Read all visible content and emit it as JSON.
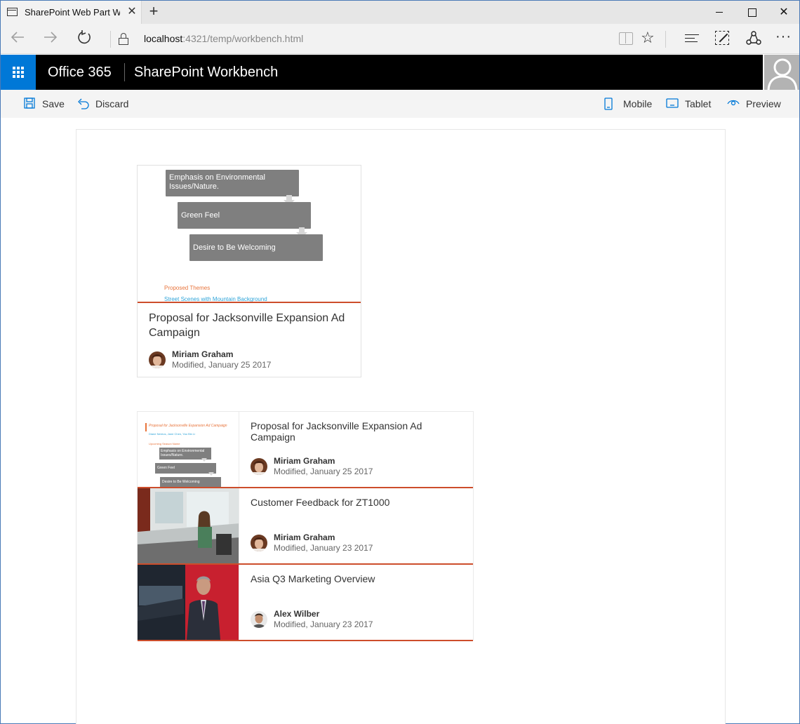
{
  "browser": {
    "tab_title": "SharePoint Web Part Wo",
    "tab_close": "✕",
    "new_tab": "+",
    "url_host": "localhost",
    "url_rest": ":4321/temp/workbench.html",
    "icons": [
      "back-icon",
      "forward-icon",
      "refresh-icon",
      "lock-icon",
      "reading-view-icon",
      "favorite-star-icon",
      "hub-icon",
      "web-note-icon",
      "share-icon",
      "more-icon"
    ]
  },
  "suitebar": {
    "brand": "Office 365",
    "title": "SharePoint Workbench",
    "accent": "#0078d7"
  },
  "commands": {
    "save": "Save",
    "discard": "Discard",
    "mobile": "Mobile",
    "tablet": "Tablet",
    "preview": "Preview"
  },
  "card": {
    "preview": {
      "box1": "Emphasis on Environmental Issues/Nature.",
      "box2": "Green Feel",
      "box3": "Desire to Be Welcoming",
      "themes": "Proposed Themes",
      "subtitle": "Street Scenes with Mountain Background"
    },
    "title": "Proposal for Jacksonville Expansion Ad Campaign",
    "author": "Miriam Graham",
    "modified": "Modified, January 25 2017"
  },
  "list": {
    "accent": "#cd4d2b",
    "items": [
      {
        "title": "Proposal for Jacksonville Expansion Ad Campaign",
        "author": "Miriam Graham",
        "modified": "Modified, January 25 2017",
        "thumb": {
          "heading": "Proposal for Jacksonville Expansion Ad Campaign",
          "sub": "Diane Nereus, Jane Chen, Yao Bin Li",
          "section": "Upcoming Season Name",
          "box1": "Emphasis on Environmental Issues/Nature.",
          "box2": "Green Feel",
          "box3": "Desire to Be Welcoming"
        }
      },
      {
        "title": "Customer Feedback for ZT1000",
        "author": "Miriam Graham",
        "modified": "Modified, January 23 2017"
      },
      {
        "title": "Asia Q3 Marketing Overview",
        "author": "Alex Wilber",
        "modified": "Modified, January 23 2017"
      }
    ]
  }
}
